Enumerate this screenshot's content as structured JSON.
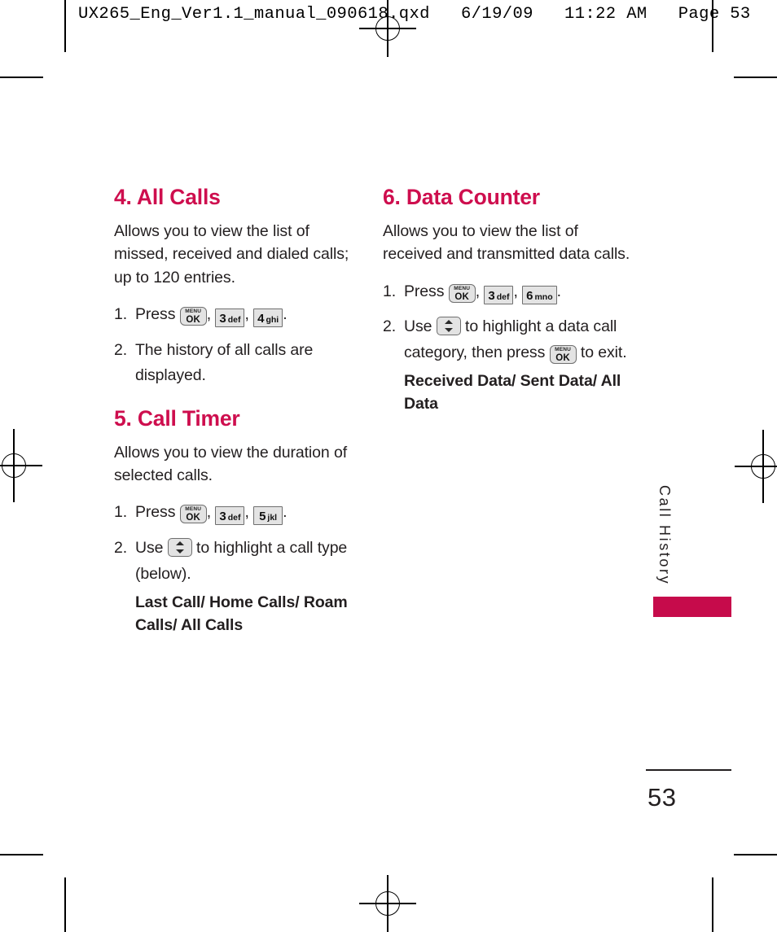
{
  "prepress": {
    "slug": "UX265_Eng_Ver1.1_manual_090618.qxd   6/19/09   11:22 AM   Page 53",
    "colors": {
      "heading": "#CE0E4E",
      "tab_block": "#C60B4B",
      "body_text": "#231F20"
    }
  },
  "sections": {
    "all_calls": {
      "title": "4. All Calls",
      "description": "Allows you to view the list of missed, received and dialed calls; up to 120 entries.",
      "step1": {
        "num": "1.",
        "press_label": "Press",
        "period": "."
      },
      "step2": {
        "num": "2.",
        "text": "The history of all calls are displayed."
      },
      "keys": {
        "menu": {
          "top": "MENU",
          "bottom": "OK",
          "name": "menu-ok-key"
        },
        "three": {
          "digit": "3",
          "letters": "def"
        },
        "four": {
          "digit": "4",
          "letters": "ghi"
        }
      }
    },
    "call_timer": {
      "title": "5. Call Timer",
      "description": "Allows you to view the duration of selected calls.",
      "step1": {
        "num": "1.",
        "press_label": "Press",
        "period": "."
      },
      "step2": {
        "num": "2.",
        "use_label": "Use",
        "text_after": "to highlight a call type (below)."
      },
      "options": "Last Call/ Home Calls/ Roam Calls/ All Calls",
      "keys": {
        "menu": {
          "top": "MENU",
          "bottom": "OK"
        },
        "three": {
          "digit": "3",
          "letters": "def"
        },
        "five": {
          "digit": "5",
          "letters": "jkl"
        }
      }
    },
    "data_counter": {
      "title": "6. Data Counter",
      "description": "Allows you to view the list of received and transmitted data calls.",
      "step1": {
        "num": "1.",
        "press_label": "Press",
        "period": "."
      },
      "step2": {
        "num": "2.",
        "use_label": "Use",
        "text_mid": "to highlight a data call category, then press",
        "text_end": "to exit."
      },
      "options": "Received Data/ Sent Data/ All Data",
      "keys": {
        "menu": {
          "top": "MENU",
          "bottom": "OK"
        },
        "three": {
          "digit": "3",
          "letters": "def"
        },
        "six": {
          "digit": "6",
          "letters": "mno"
        }
      }
    }
  },
  "side_tab": {
    "label": "Call History"
  },
  "folio": {
    "page_number": "53"
  },
  "separators": {
    "comma": ",",
    "period": "."
  }
}
